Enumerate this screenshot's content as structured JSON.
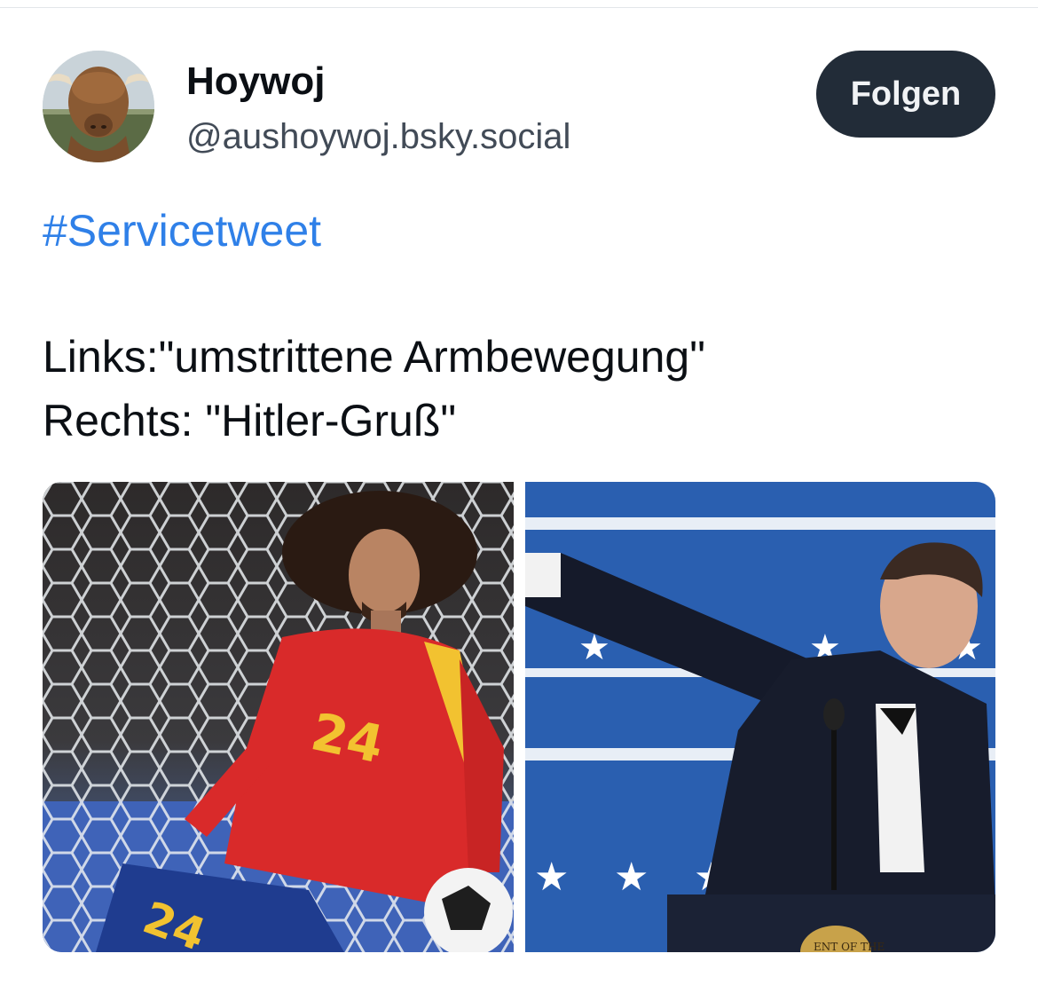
{
  "post": {
    "author": {
      "display_name": "Hoywoj",
      "handle": "@aushoywoj.bsky.social",
      "avatar_icon": "highland-cow-avatar"
    },
    "follow_button_label": "Folgen",
    "hashtag": "#Servicetweet",
    "text_lines": [
      "Links:\"umstrittene Armbewegung\"",
      "Rechts: \"Hitler-Gruß\""
    ],
    "images": [
      {
        "name": "soccer-player-photo",
        "visible_text": [
          "24",
          "24"
        ]
      },
      {
        "name": "speaker-at-podium-photo",
        "visible_text": [
          "ENT OF THE"
        ]
      }
    ]
  },
  "colors": {
    "link": "#2f80e8",
    "follow_button_bg": "#222c38",
    "handle": "#424b57",
    "text": "#0b0f14"
  }
}
